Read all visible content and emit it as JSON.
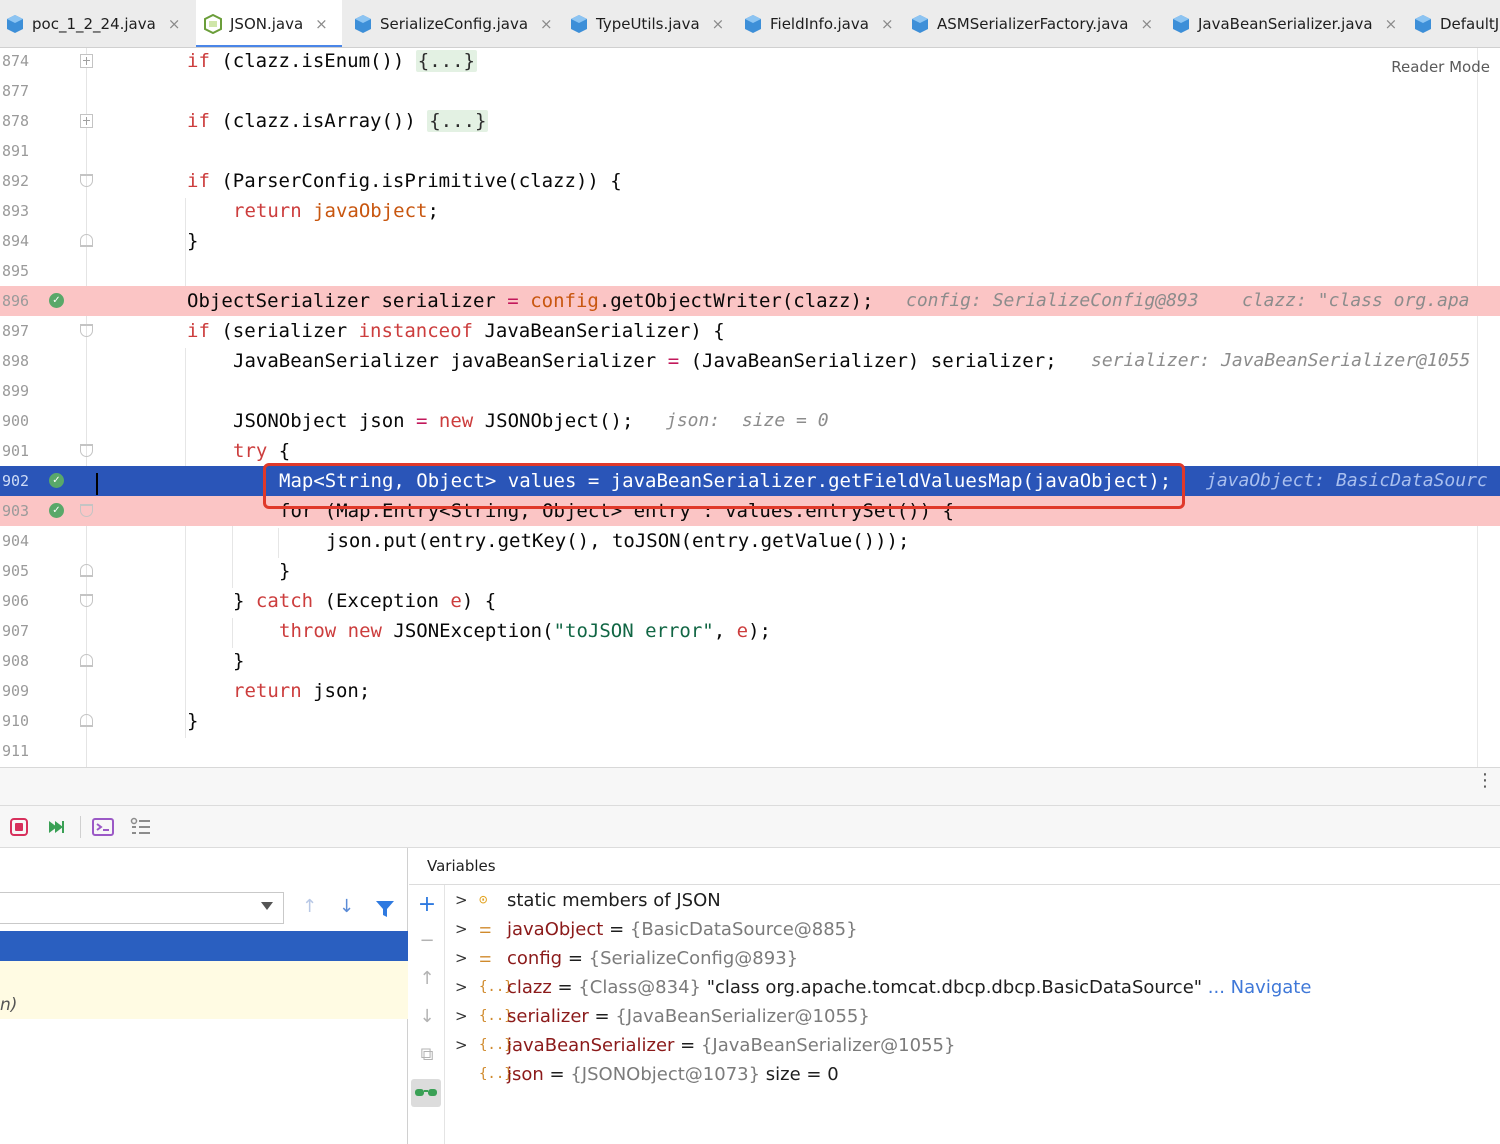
{
  "tabs": [
    {
      "label": "poc_1_2_24.java",
      "close": "×",
      "active": false
    },
    {
      "label": "JSON.java",
      "close": "×",
      "active": true
    },
    {
      "label": "SerializeConfig.java",
      "close": "×",
      "active": false
    },
    {
      "label": "TypeUtils.java",
      "close": "×",
      "active": false
    },
    {
      "label": "FieldInfo.java",
      "close": "×",
      "active": false
    },
    {
      "label": "ASMSerializerFactory.java",
      "close": "×",
      "active": false
    },
    {
      "label": "JavaBeanSerializer.java",
      "close": "×",
      "active": false
    },
    {
      "label": "DefaultJ",
      "close": "",
      "active": false
    }
  ],
  "editor": {
    "reader_mode": "Reader Mode",
    "lines": [
      {
        "n": "874",
        "t1": "if",
        "t2": " (clazz.isEnum()) ",
        "fold": "{...}"
      },
      {
        "n": "877"
      },
      {
        "n": "878",
        "t1": "if",
        "t2": " (clazz.isArray()) ",
        "fold": "{...}"
      },
      {
        "n": "891"
      },
      {
        "n": "892",
        "t1": "if",
        "t2": " (ParserConfig.isPrimitive(clazz)) {"
      },
      {
        "n": "893",
        "t1": "return",
        "t2": " ",
        "t3": "javaObject",
        "t4": ";"
      },
      {
        "n": "894",
        "t2": "}"
      },
      {
        "n": "895"
      },
      {
        "n": "896",
        "t2": "ObjectSerializer serializer ",
        "t1": "=",
        "t3": "config",
        "t4": ".getObjectWriter(clazz);",
        "hint": "config: SerializeConfig@893    clazz: \"class org.apa"
      },
      {
        "n": "897",
        "t1": "if",
        "t2": " (serializer ",
        "t3": "instanceof",
        "t4": " JavaBeanSerializer) {"
      },
      {
        "n": "898",
        "t2": "JavaBeanSerializer javaBeanSerializer ",
        "t1": "=",
        "t4": " (JavaBeanSerializer) serializer;",
        "hint": "serializer: JavaBeanSerializer@1055"
      },
      {
        "n": "899"
      },
      {
        "n": "900",
        "t2": "JSONObject json ",
        "t1": "=",
        "t3": " new",
        "t4": " JSONObject();",
        "hint": "json:  size = 0"
      },
      {
        "n": "901",
        "t1": "try",
        "t2": " {"
      },
      {
        "n": "902",
        "t2": "Map<String, Object> values = javaBeanSerializer.getFieldValuesMap(javaObject);",
        "hint": "javaObject: BasicDataSourc"
      },
      {
        "n": "903",
        "t2": "for (Map.Entry<String, Object> entry : values.entrySet()) {"
      },
      {
        "n": "904",
        "t2": "json.put(entry.getKey(), toJSON(entry.getValue()));"
      },
      {
        "n": "905",
        "t2": "}"
      },
      {
        "n": "906",
        "t2": "} ",
        "t1": "catch",
        "t4": " (Exception ",
        "t3": "e",
        "t5": ") {"
      },
      {
        "n": "907",
        "t1": "throw",
        "t3": " new",
        "t4": " JSONException(",
        "s": "\"toJSON error\"",
        "t5": ", ",
        "t6": "e",
        "t7": ");"
      },
      {
        "n": "908",
        "t2": "}"
      },
      {
        "n": "909",
        "t1": "return",
        "t2": " json;"
      },
      {
        "n": "910",
        "t2": "}"
      },
      {
        "n": "911"
      }
    ]
  },
  "panel": {
    "kebab": "⋮",
    "variables_title": "Variables",
    "frame_row_text": "n)",
    "variables": [
      {
        "name": "static members of JSON",
        "eq": "",
        "value": "",
        "extra": "",
        "nav": "",
        "icon": "static-icon",
        "expand": ">"
      },
      {
        "name": "javaObject",
        "eq": " = ",
        "value": "{BasicDataSource@885}",
        "extra": "",
        "nav": "",
        "icon": "field-icon",
        "expand": ">"
      },
      {
        "name": "config",
        "eq": " = ",
        "value": "{SerializeConfig@893}",
        "extra": "",
        "nav": "",
        "icon": "field-icon",
        "expand": ">"
      },
      {
        "name": "clazz",
        "eq": " = ",
        "value": "{Class@834}",
        "extra": " \"class org.apache.tomcat.dbcp.dbcp.BasicDataSource\"",
        "nav": " ... Navigate",
        "icon": "local-icon",
        "expand": ">"
      },
      {
        "name": "serializer",
        "eq": " = ",
        "value": "{JavaBeanSerializer@1055}",
        "extra": "",
        "nav": "",
        "icon": "local-icon",
        "expand": ">"
      },
      {
        "name": "javaBeanSerializer",
        "eq": " = ",
        "value": "{JavaBeanSerializer@1055}",
        "extra": "",
        "nav": "",
        "icon": "local-icon",
        "expand": ">"
      },
      {
        "name": "json",
        "eq": " = ",
        "value": "{JSONObject@1073}",
        "extra": "  size = 0",
        "nav": "",
        "icon": "local-icon",
        "expand": ""
      }
    ]
  },
  "colors": {
    "breakpoint_line": "#fbc5c5",
    "execution_line": "#2a55b8",
    "highlight_box": "#e0392a",
    "accent": "#4a86e8"
  }
}
